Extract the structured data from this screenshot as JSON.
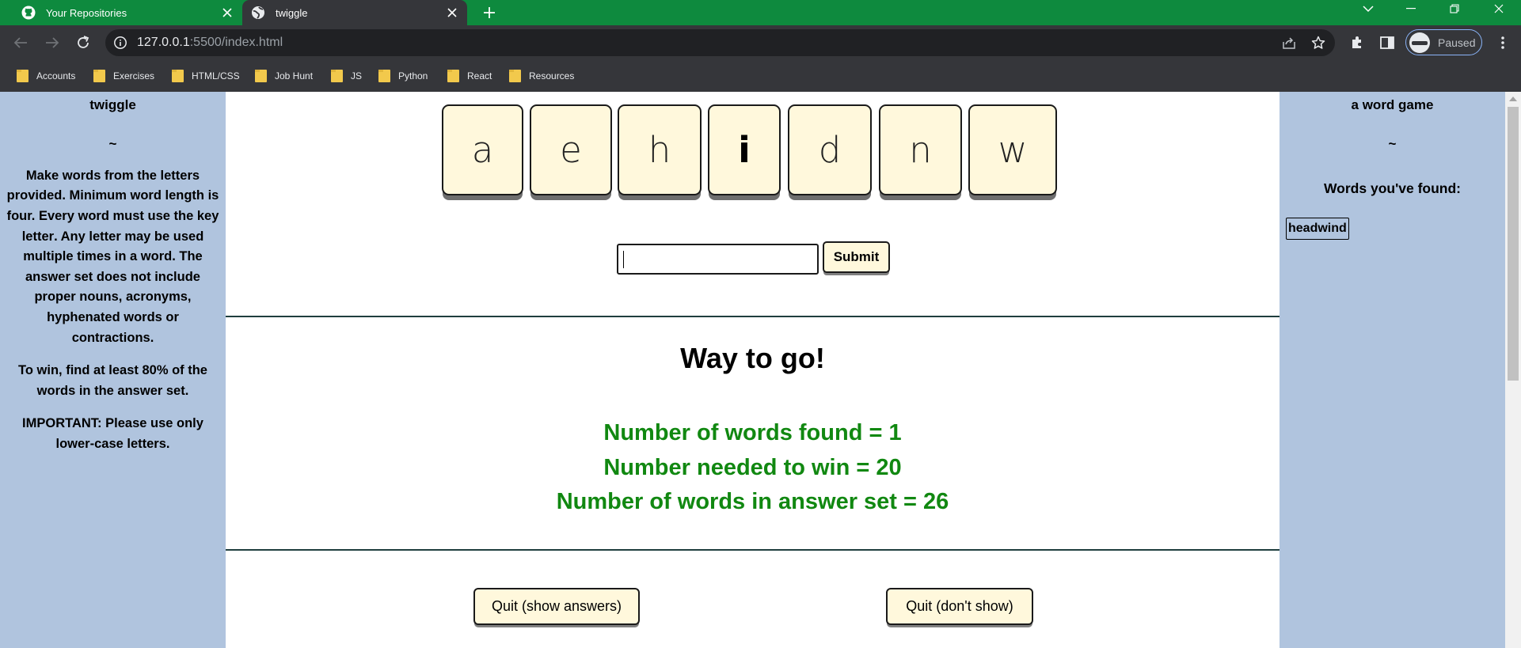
{
  "browser": {
    "tabs": [
      {
        "title": "Your Repositories",
        "icon": "github-icon",
        "active": false
      },
      {
        "title": "twiggle",
        "icon": "globe-icon",
        "active": true
      }
    ],
    "url_host": "127.0.0.1",
    "url_rest": ":5500/index.html",
    "profile_label": "Paused",
    "bookmarks": [
      "Accounts",
      "Exercises",
      "HTML/CSS",
      "Job Hunt",
      "JS",
      "Python",
      "React",
      "Resources"
    ],
    "colors": {
      "tabbar": "#0e8a3e",
      "toolbar": "#35363a",
      "omnibox": "#202124"
    }
  },
  "left_panel": {
    "title": "twiggle",
    "tilde": "~",
    "rules_part1": "Make words from the letters provided. Minimum word length is four. Every word must use the ",
    "rules_key": "key letter",
    "rules_part2": ". Any letter may be used multiple times in a word. The answer set does not include proper nouns, acronyms, hyphenated words or contractions.",
    "win_rule": "To win, find at least 80% of the words in the answer set.",
    "important_label": "IMPORTANT:",
    "important_text": " Please use only lower-case letters."
  },
  "right_panel": {
    "title": "a word game",
    "tilde": "~",
    "found_label": "Words you've found:",
    "found_words": [
      "headwind"
    ]
  },
  "game": {
    "letters": [
      "a",
      "e",
      "h",
      "i",
      "d",
      "n",
      "w"
    ],
    "key_letter_index": 3,
    "input_value": "",
    "submit_label": "Submit",
    "message": "Way to go!",
    "stats": [
      "Number of words found = 1",
      "Number needed to win = 20",
      "Number of words in answer set = 26"
    ],
    "quit_show_label": "Quit (show answers)",
    "quit_noshow_label": "Quit (don't show)",
    "colors": {
      "panel": "#b0c4de",
      "tile": "#fff8dc",
      "stat_text": "#118811"
    }
  }
}
